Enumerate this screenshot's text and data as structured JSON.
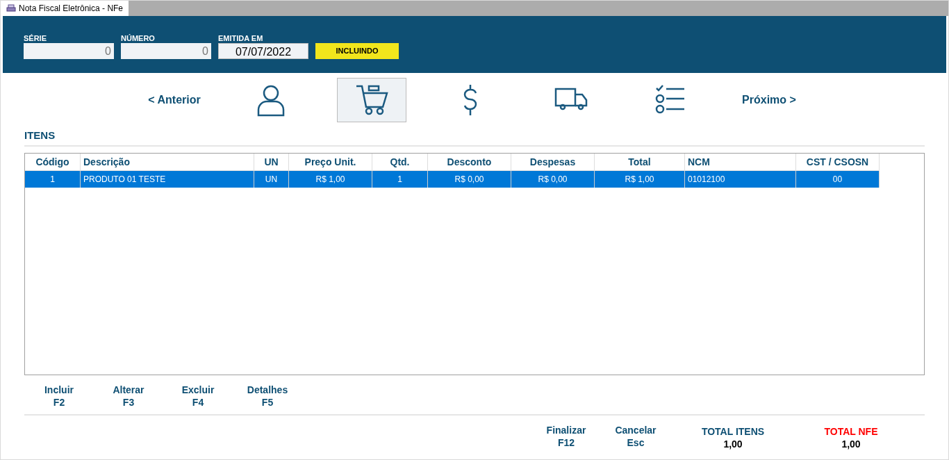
{
  "window": {
    "title": "Nota Fiscal Eletrônica - NFe"
  },
  "header": {
    "fields": [
      {
        "label": "SÉRIE",
        "value": "0",
        "disabled": true
      },
      {
        "label": "NÚMERO",
        "value": "0",
        "disabled": true
      },
      {
        "label": "EMITIDA EM",
        "value": "07/07/2022",
        "disabled": false
      }
    ],
    "status": "INCLUINDO"
  },
  "steps": {
    "previous": "< Anterior",
    "next": "Próximo >",
    "items": [
      {
        "kind": "person",
        "selected": false
      },
      {
        "kind": "cart",
        "selected": true
      },
      {
        "kind": "dollar",
        "selected": false
      },
      {
        "kind": "truck",
        "selected": false
      },
      {
        "kind": "checklist",
        "selected": false
      }
    ]
  },
  "section_title": "ITENS",
  "table": {
    "columns": [
      "Código",
      "Descrição",
      "UN",
      "Preço Unit.",
      "Qtd.",
      "Desconto",
      "Despesas",
      "Total",
      "NCM",
      "CST / CSOSN"
    ],
    "rows": [
      {
        "selected": true,
        "cells": [
          "1",
          "PRODUTO 01 TESTE",
          "UN",
          "R$ 1,00",
          "1",
          "R$ 0,00",
          "R$ 0,00",
          "R$ 1,00",
          "01012100",
          "00"
        ]
      }
    ]
  },
  "item_actions": [
    {
      "label": "Incluir",
      "key": "F2"
    },
    {
      "label": "Alterar",
      "key": "F3"
    },
    {
      "label": "Excluir",
      "key": "F4"
    },
    {
      "label": "Detalhes",
      "key": "F5"
    }
  ],
  "footer_actions": [
    {
      "label": "Finalizar",
      "key": "F12"
    },
    {
      "label": "Cancelar",
      "key": "Esc"
    }
  ],
  "totals": [
    {
      "label": "TOTAL ITENS",
      "value": "1,00",
      "kind": "normal"
    },
    {
      "label": "TOTAL NFE",
      "value": "1,00",
      "kind": "highlight"
    }
  ]
}
